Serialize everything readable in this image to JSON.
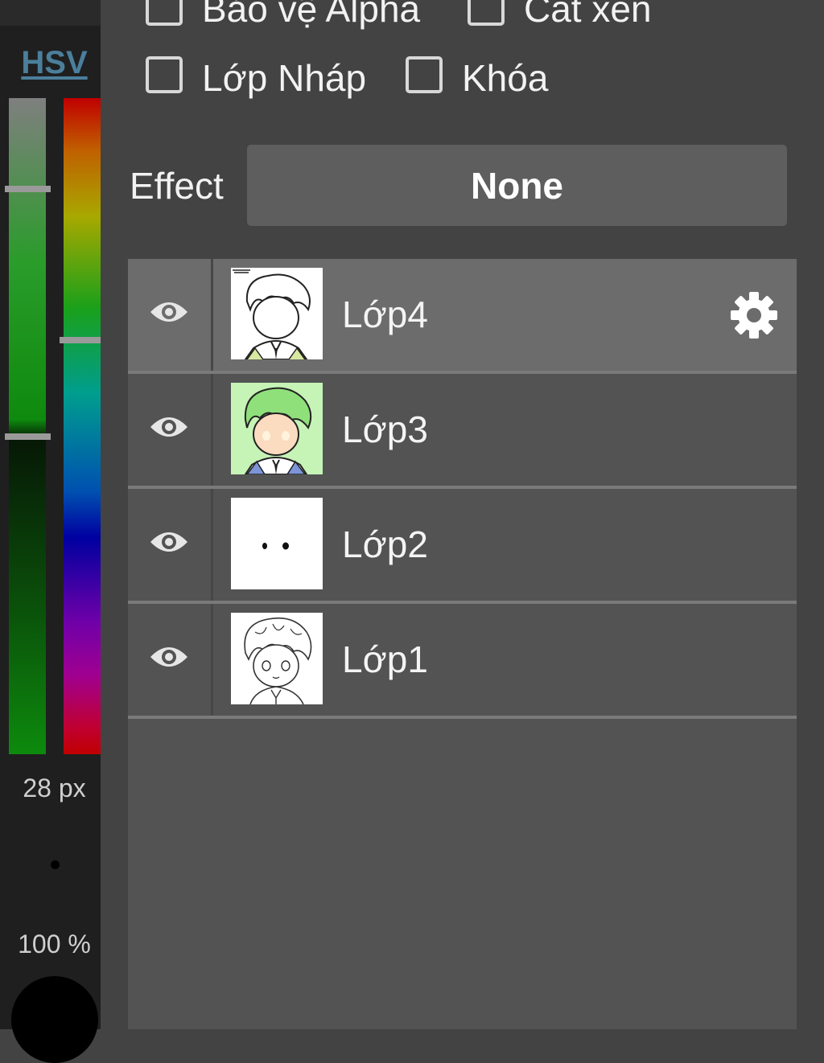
{
  "left_panel": {
    "color_mode": "HSV",
    "brush_size": "28 px",
    "opacity": "100 %"
  },
  "layer_options": {
    "checkboxes": [
      {
        "label": "Bảo vệ Alpha",
        "checked": false
      },
      {
        "label": "Cắt xén",
        "checked": false
      },
      {
        "label": "Lớp Nháp",
        "checked": false
      },
      {
        "label": "Khóa",
        "checked": false
      }
    ],
    "effect_label": "Effect",
    "effect_value": "None"
  },
  "layers": [
    {
      "name": "Lớp4",
      "visible": true,
      "selected": true,
      "thumb": "line-art-with-sign"
    },
    {
      "name": "Lớp3",
      "visible": true,
      "selected": false,
      "thumb": "colored-green"
    },
    {
      "name": "Lớp2",
      "visible": true,
      "selected": false,
      "thumb": "eyes-only"
    },
    {
      "name": "Lớp1",
      "visible": true,
      "selected": false,
      "thumb": "sketch"
    }
  ],
  "icons": {
    "visibility": "eye-icon",
    "settings": "gear-icon"
  }
}
